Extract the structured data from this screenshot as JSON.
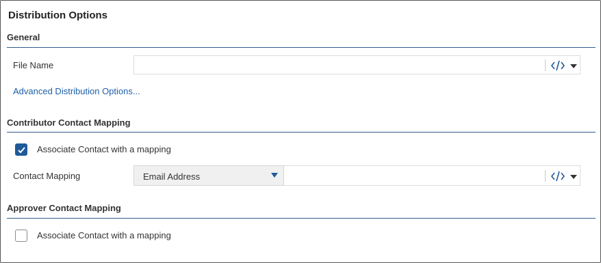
{
  "panel": {
    "title": "Distribution Options"
  },
  "general": {
    "heading": "General",
    "file_name_label": "File Name",
    "file_name_value": "",
    "advanced_link": "Advanced Distribution Options..."
  },
  "contributor": {
    "heading": "Contributor Contact Mapping",
    "associate_label": "Associate Contact with a mapping",
    "associate_checked": true,
    "contact_mapping_label": "Contact Mapping",
    "contact_mapping_value": "Email Address"
  },
  "approver": {
    "heading": "Approver Contact Mapping",
    "associate_label": "Associate Contact with a mapping",
    "associate_checked": false
  },
  "icons": {
    "code": "code-icon",
    "caret": "caret-down-icon",
    "check": "checkmark-icon"
  },
  "colors": {
    "accent": "#1e5a9a",
    "link": "#1f5fa8",
    "rule": "#2f5b8a"
  }
}
